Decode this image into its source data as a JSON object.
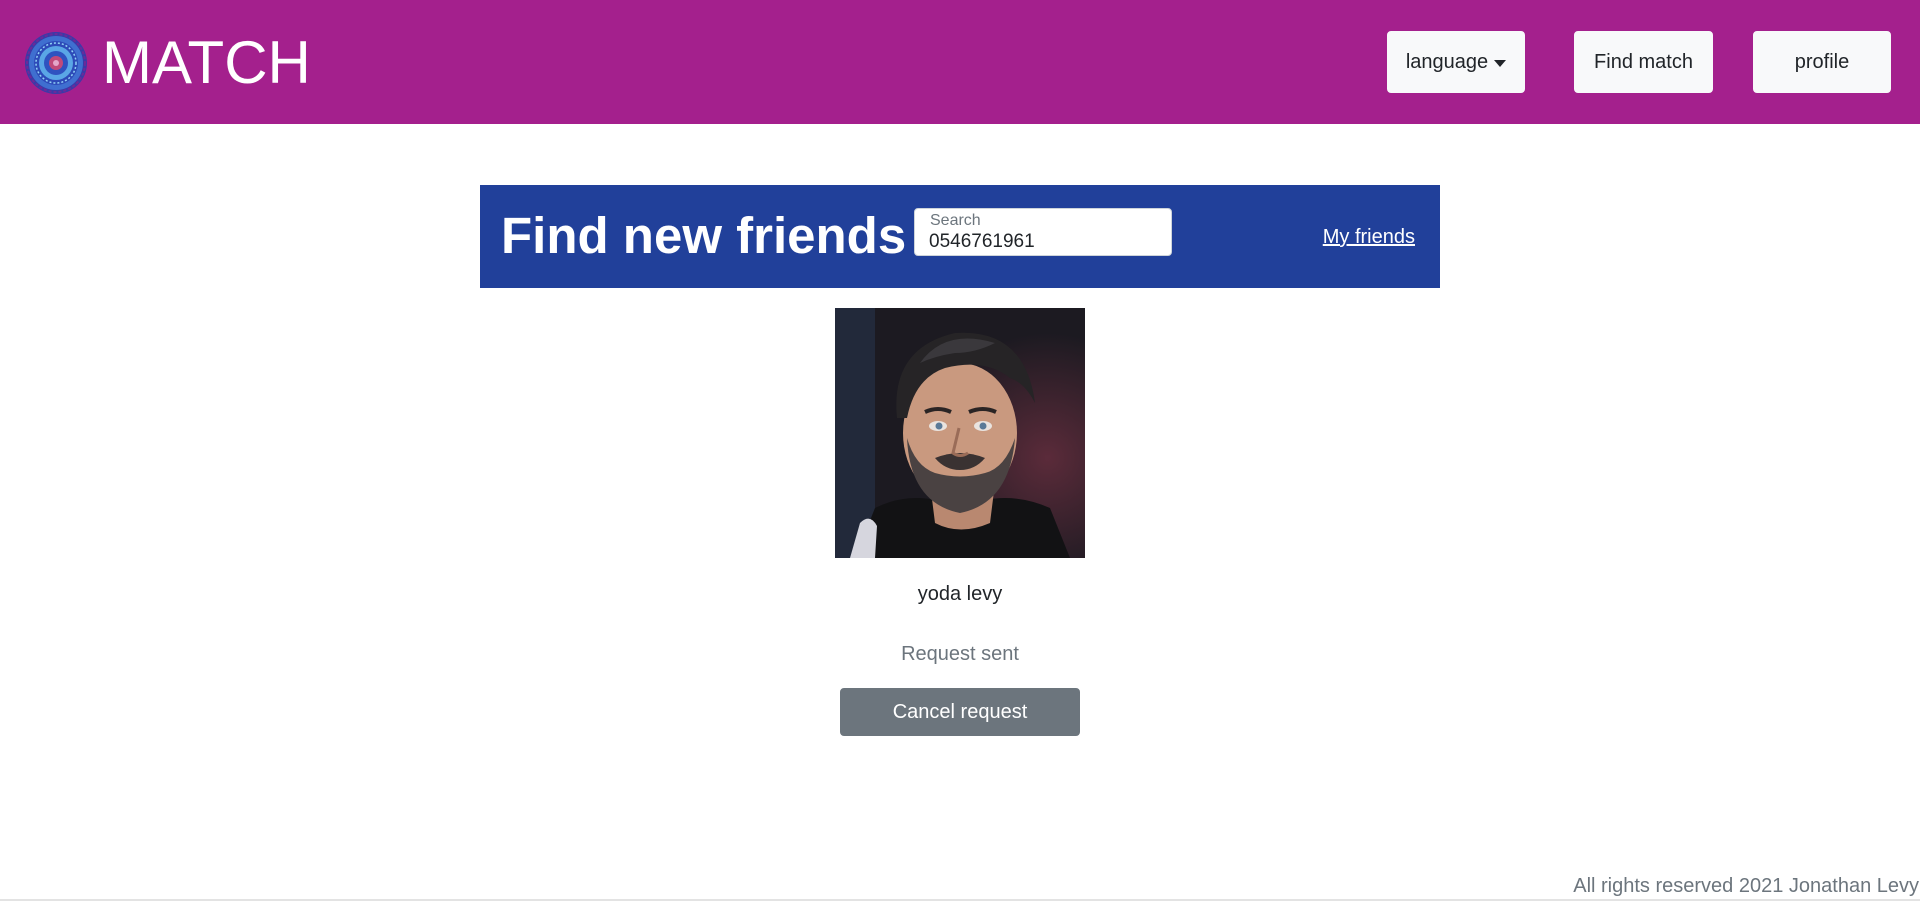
{
  "navbar": {
    "brand_title": "MATCH",
    "logo_icon": "mandala-logo-icon",
    "language_label": "language",
    "find_match_label": "Find match",
    "profile_label": "profile",
    "background_color": "#a4208d"
  },
  "search_section": {
    "title": "Find new friends",
    "search_placeholder": "Search",
    "search_value": "0546761961",
    "my_friends_link": "My friends",
    "background_color": "#21409a"
  },
  "result": {
    "photo_icon": "profile-photo",
    "name": "yoda levy",
    "status": "Request sent",
    "cancel_label": "Cancel request",
    "button_color": "#6c757d"
  },
  "footer": {
    "text": "All rights reserved 2021 Jonathan Levy"
  }
}
